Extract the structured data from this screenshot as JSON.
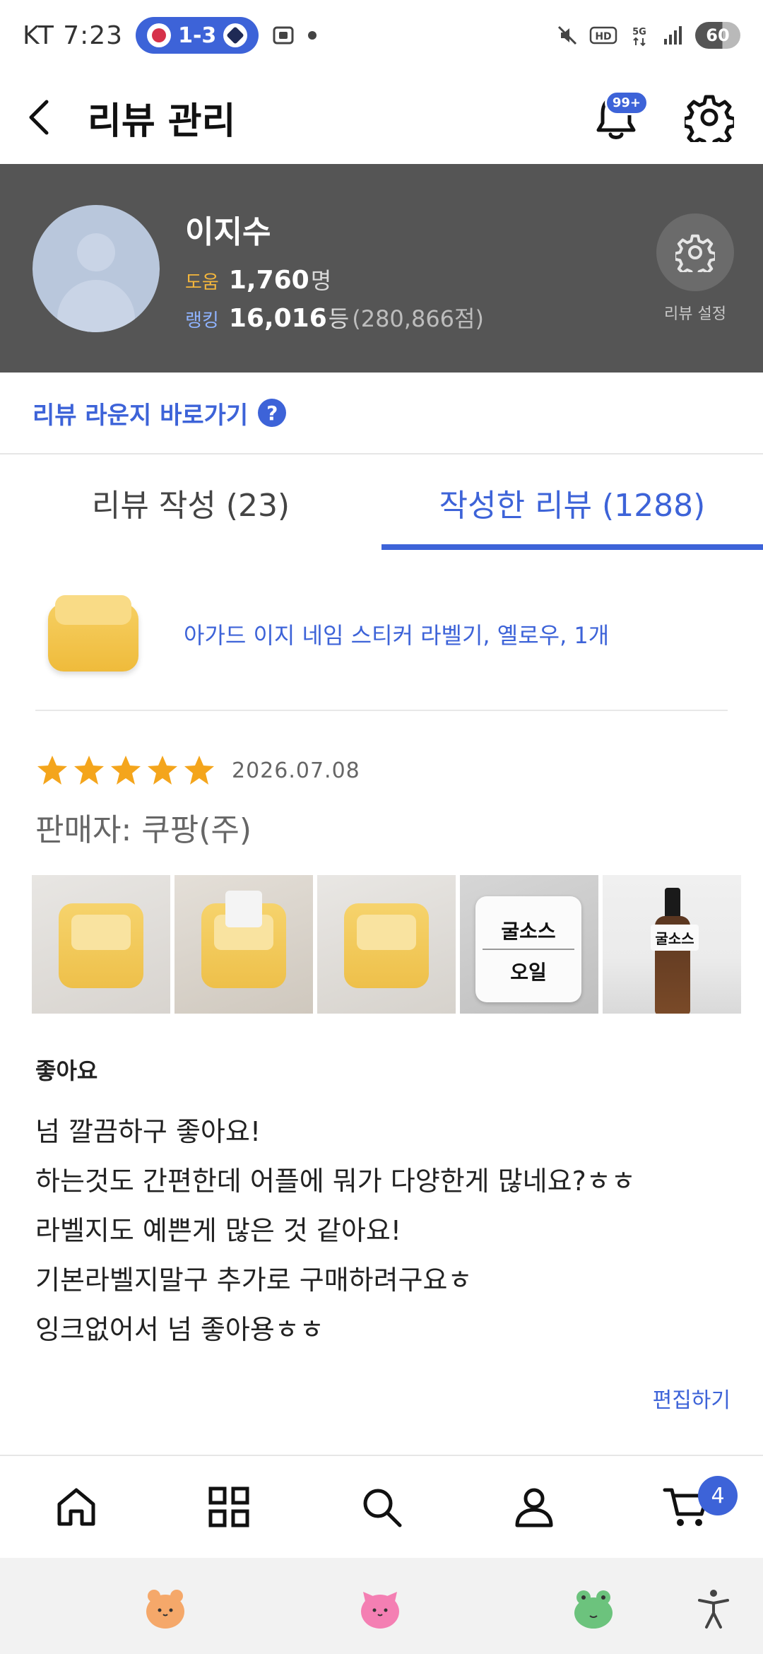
{
  "status_bar": {
    "carrier_time": "KT 7:23",
    "score": "1-3",
    "battery": "60"
  },
  "header": {
    "title": "리뷰 관리",
    "notification_badge": "99+"
  },
  "profile": {
    "name": "이지수",
    "help_label": "도움",
    "help_value": "1,760",
    "help_unit": "명",
    "rank_label": "랭킹",
    "rank_value": "16,016",
    "rank_unit": "등",
    "rank_points": "(280,866점)",
    "setting_label": "리뷰 설정"
  },
  "lounge": {
    "label": "리뷰 라운지 바로가기",
    "help_icon_text": "?"
  },
  "tabs": [
    {
      "label": "리뷰 작성 (23)",
      "active": false
    },
    {
      "label": "작성한 리뷰 (1288)",
      "active": true
    }
  ],
  "product": {
    "name": "아가드 이지 네임 스티커 라벨기, 옐로우, 1개"
  },
  "review": {
    "rating": 5,
    "date": "2026.07.08",
    "seller": "판매자: 쿠팡(주)",
    "photos": [
      {
        "label_top": "",
        "label_bottom": ""
      },
      {
        "label_top": "",
        "label_bottom": ""
      },
      {
        "label_top": "",
        "label_bottom": ""
      },
      {
        "label_top": "굴소스",
        "label_bottom": "오일"
      },
      {
        "label_top": "굴소스",
        "label_bottom": ""
      }
    ],
    "title": "좋아요",
    "lines": [
      "넘 깔끔하구 좋아요!",
      "하는것도 간편한데 어플에 뭐가 다양한게 많네요?ㅎㅎ",
      "라벨지도 예쁜게 많은 것 같아요!",
      "기본라벨지말구 추가로 구매하려구요ㅎ",
      "잉크없어서 넘 좋아용ㅎㅎ"
    ],
    "edit_label": "편집하기"
  },
  "bottom_nav": {
    "items": [
      "home-icon",
      "categories-icon",
      "search-icon",
      "account-icon",
      "cart-icon"
    ],
    "cart_count": "4"
  },
  "colors": {
    "accent": "#3d63d8",
    "profile_bg": "#555555",
    "star": "#f4a51c"
  }
}
